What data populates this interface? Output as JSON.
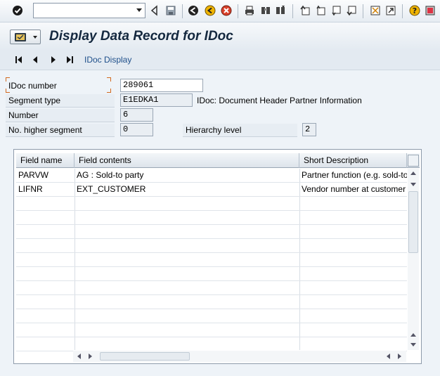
{
  "command_field": {
    "value": ""
  },
  "toolbar_icons": [
    "enter-icon",
    "back-icon",
    "save-icon",
    "back-green-icon",
    "exit-icon",
    "cancel-icon",
    "print-icon",
    "find-icon",
    "find-next-icon",
    "first-page-icon",
    "previous-page-icon",
    "next-page-icon",
    "last-page-icon",
    "create-session-icon",
    "shortcut-icon",
    "help-icon",
    "layout-menu-icon"
  ],
  "title": "Display Data Record for IDoc",
  "app_toolbar": {
    "nav_icons": [
      "first-icon",
      "previous-icon",
      "next-icon",
      "last-icon"
    ],
    "idoc_display_label": "IDoc Display"
  },
  "header": {
    "idoc_number": {
      "label": "IDoc number",
      "value": "289061"
    },
    "segment_type": {
      "label": "Segment type",
      "value": "E1EDKA1",
      "description": "IDoc: Document Header Partner Information"
    },
    "number": {
      "label": "Number",
      "value": "6"
    },
    "higher_segment": {
      "label": "No. higher segment",
      "value": "0"
    },
    "hierarchy_level": {
      "label": "Hierarchy level",
      "value": "2"
    }
  },
  "table": {
    "columns": [
      "Field name",
      "Field contents",
      "Short Description"
    ],
    "rows": [
      {
        "field_name": "PARVW",
        "field_contents": "AG  : Sold-to party",
        "short_description": "Partner function (e.g. sold-to"
      },
      {
        "field_name": "LIFNR",
        "field_contents": "EXT_CUSTOMER",
        "short_description": "Vendor number at customer"
      }
    ],
    "empty_rows": 11
  }
}
